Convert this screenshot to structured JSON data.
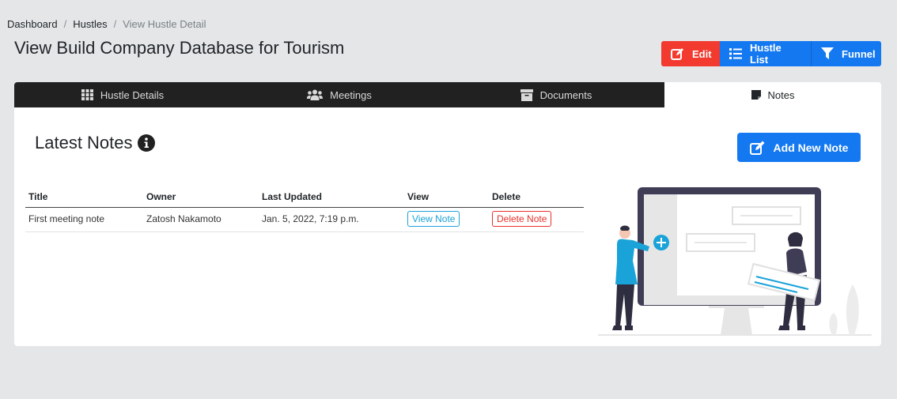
{
  "breadcrumb": {
    "items": [
      {
        "label": "Dashboard"
      },
      {
        "label": "Hustles"
      },
      {
        "label": "View Hustle Detail"
      }
    ],
    "separator": "/"
  },
  "page": {
    "title": "View Build Company Database for Tourism"
  },
  "actions": {
    "edit_label": "Edit",
    "list_label": "Hustle List",
    "funnel_label": "Funnel"
  },
  "tabs": [
    {
      "label": "Hustle Details",
      "icon": "grid-icon"
    },
    {
      "label": "Meetings",
      "icon": "users-icon"
    },
    {
      "label": "Documents",
      "icon": "archive-icon"
    },
    {
      "label": "Notes",
      "icon": "sticky-note-icon",
      "active": true
    }
  ],
  "notes": {
    "title": "Latest Notes",
    "add_label": "Add New Note",
    "columns": [
      "Title",
      "Owner",
      "Last Updated",
      "View",
      "Delete"
    ],
    "rows": [
      {
        "title": "First meeting note",
        "owner": "Zatosh Nakamoto",
        "updated": "Jan. 5, 2022, 7:19 p.m.",
        "view_label": "View Note",
        "delete_label": "Delete Note"
      }
    ]
  },
  "colors": {
    "background": "#e4e6e8",
    "danger": "#f23a2f",
    "primary": "#1479f0",
    "tab_dark": "#212121",
    "info_link": "#1aa3d8"
  }
}
